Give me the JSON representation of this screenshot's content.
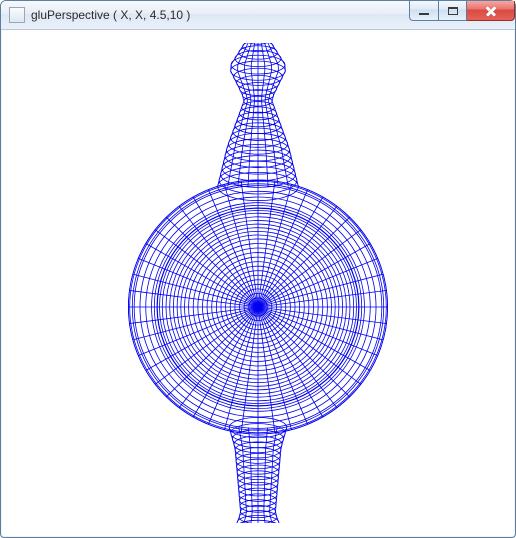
{
  "window": {
    "title": "gluPerspective ( X, X, 4.5,10 )",
    "icon_name": "app-icon",
    "controls": {
      "minimize": "Minimize",
      "maximize": "Maximize",
      "close": "Close"
    }
  },
  "render": {
    "api_call": "gluPerspective",
    "params_visible": [
      "X",
      "X",
      "4.5",
      "10"
    ],
    "object": "Utah teapot (wireframe, top view)",
    "wire_color": "#0000ee",
    "background": "#ffffff"
  }
}
